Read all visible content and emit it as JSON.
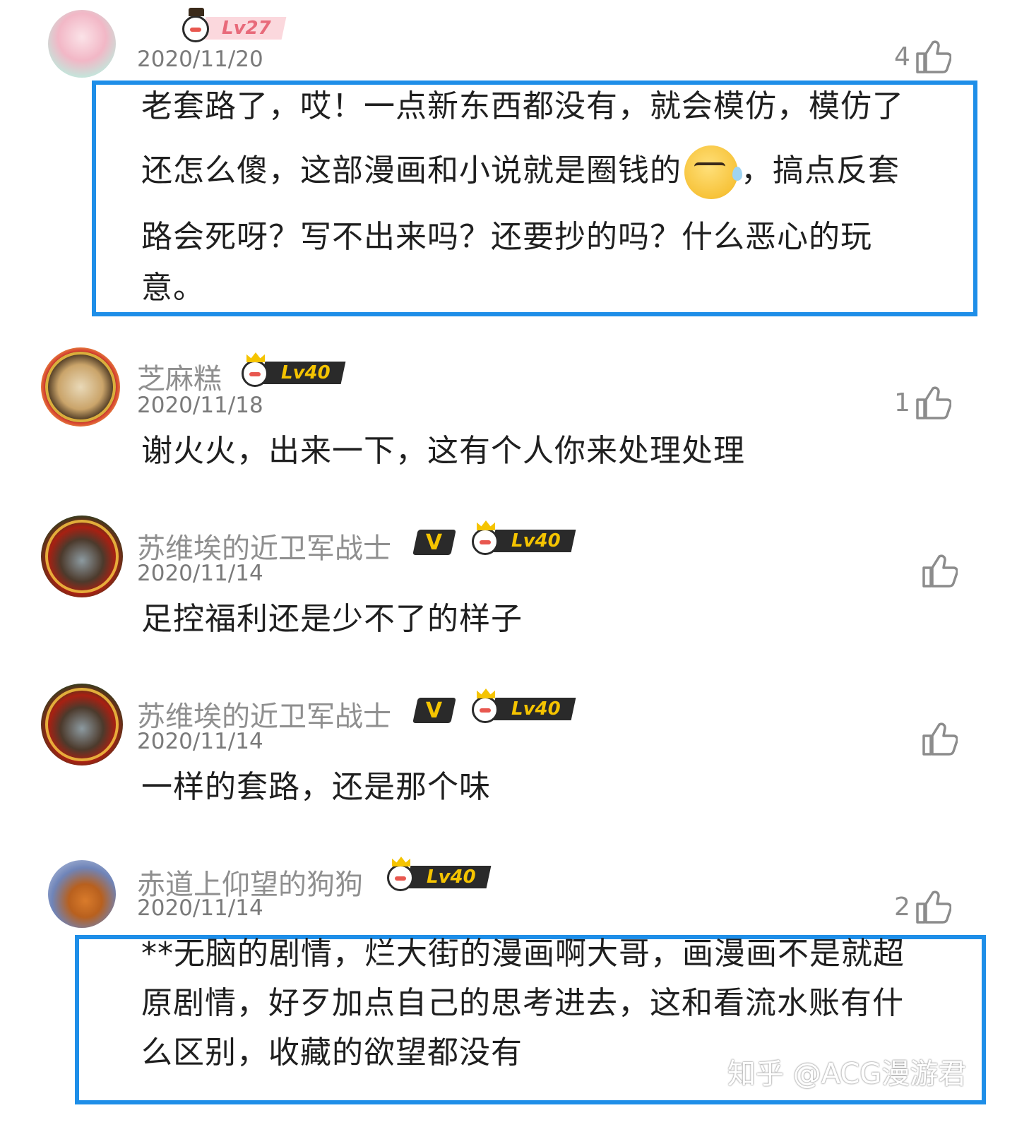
{
  "comments": [
    {
      "username": "",
      "level": "Lv27",
      "date": "2020/11/20",
      "likes": "4",
      "vip": "",
      "lines": [
        "老套路了，哎！一点新东西都没有，就会模仿，模仿了",
        "还怎么傻，这部漫画和小说就是圈钱的",
        "，搞点反套",
        "路会死呀？写不出来吗？还要抄的吗？什么恶心的玩",
        "意。"
      ]
    },
    {
      "username": "芝麻糕",
      "level": "Lv40",
      "date": "2020/11/18",
      "likes": "1",
      "vip": "",
      "lines": [
        "谢火火，出来一下，这有个人你来处理处理"
      ]
    },
    {
      "username": "苏维埃的近卫军战士",
      "level": "Lv40",
      "date": "2020/11/14",
      "likes": "",
      "vip": "V",
      "lines": [
        "足控福利还是少不了的样子"
      ]
    },
    {
      "username": "苏维埃的近卫军战士",
      "level": "Lv40",
      "date": "2020/11/14",
      "likes": "",
      "vip": "V",
      "lines": [
        "一样的套路，还是那个味"
      ]
    },
    {
      "username": "赤道上仰望的狗狗",
      "level": "Lv40",
      "date": "2020/11/14",
      "likes": "2",
      "vip": "",
      "lines": [
        "**无脑的剧情，烂大街的漫画啊大哥，画漫画不是就超",
        "原剧情，好歹加点自己的思考进去，这和看流水账有什",
        "么区别，收藏的欲望都没有"
      ]
    }
  ],
  "emoji_names": [
    "thumbs-up-icon",
    "sweating-sneer-emoji",
    "level-mascot-icon",
    "crown-icon"
  ],
  "colors": {
    "highlight": "#1e8ee8",
    "username": "#8f8f8f",
    "level_gold": "#f5c400",
    "level_pink": "#e86a7a"
  },
  "watermark": "知乎 @ACG漫游君"
}
